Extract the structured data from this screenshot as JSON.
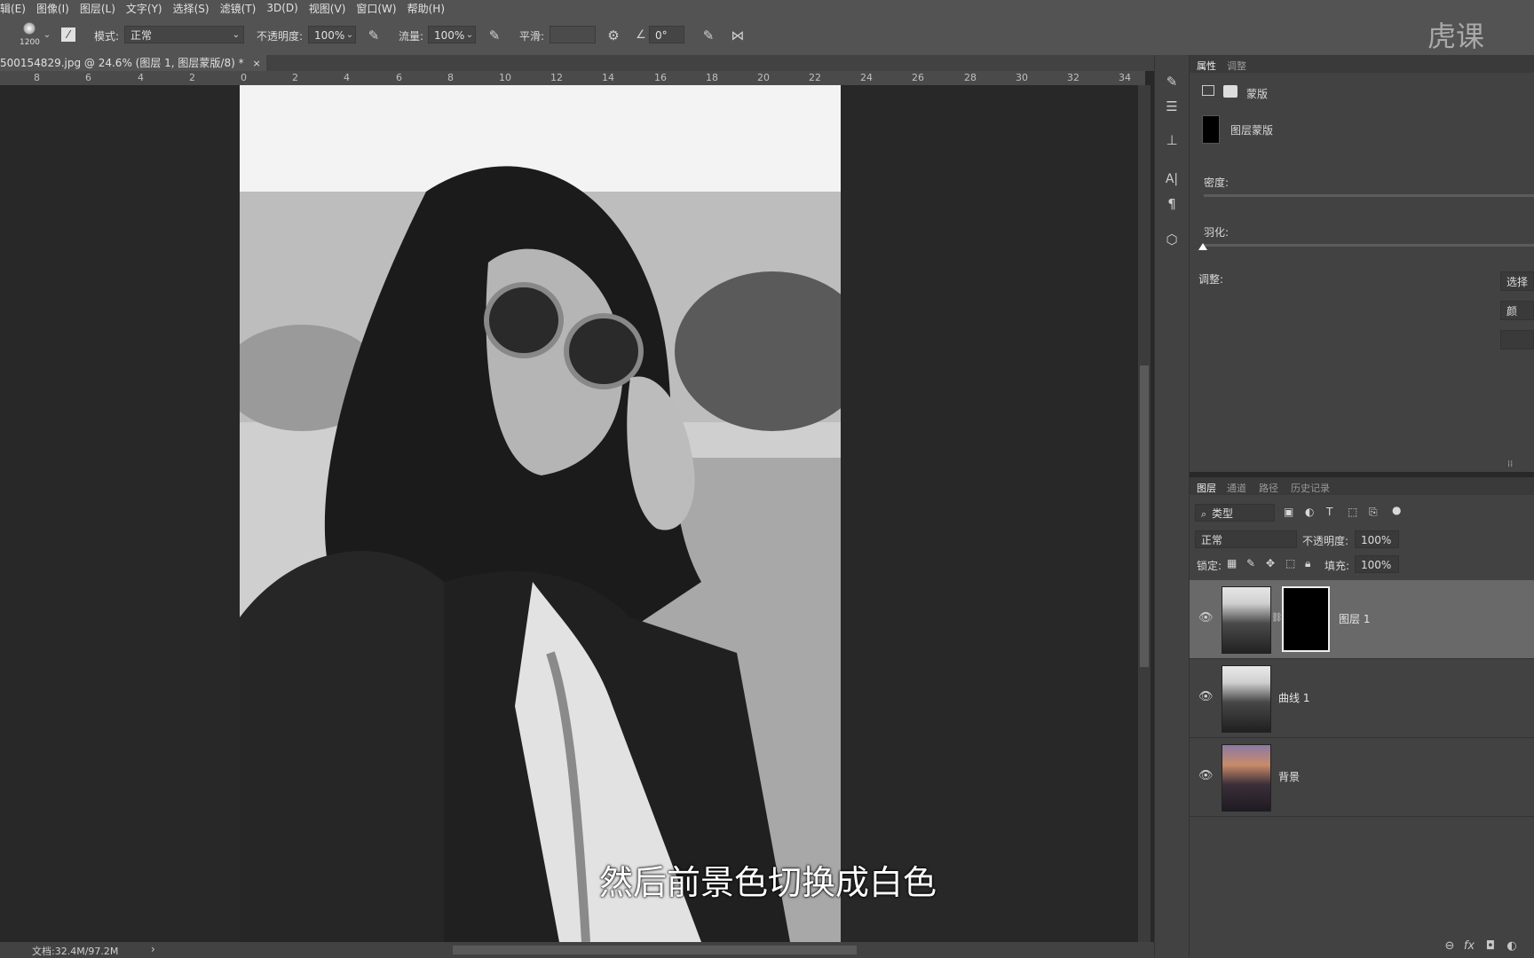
{
  "menu": [
    "辑(E)",
    "图像(I)",
    "图层(L)",
    "文字(Y)",
    "选择(S)",
    "滤镜(T)",
    "3D(D)",
    "视图(V)",
    "窗口(W)",
    "帮助(H)"
  ],
  "options": {
    "brush_size": "1200",
    "mode_label": "模式:",
    "mode_value": "正常",
    "opacity_label": "不透明度:",
    "opacity_value": "100%",
    "flow_label": "流量:",
    "flow_value": "100%",
    "smooth_label": "平滑:",
    "smooth_value": "",
    "angle_value": "0°"
  },
  "brand": "虎课",
  "document": {
    "tab_title": "500154829.jpg @ 24.6% (图层 1, 图层蒙版/8) *",
    "close_glyph": "×",
    "ruler_marks": [
      "8",
      "6",
      "4",
      "2",
      "0",
      "2",
      "4",
      "6",
      "8",
      "10",
      "12",
      "14",
      "16",
      "18",
      "20",
      "22",
      "24",
      "26",
      "28",
      "30",
      "32",
      "34"
    ],
    "subtitle": "然后前景色切换成白色",
    "status_text": "文档:32.4M/97.2M",
    "status_arrow": "›"
  },
  "properties_panel": {
    "tabs": [
      "属性",
      "调整"
    ],
    "mask_header": "蒙版",
    "layer_mask_label": "图层蒙版",
    "density_label": "密度:",
    "feather_label": "羽化:",
    "adjust_label": "调整:",
    "btn_select": "选择",
    "btn_color": "颜"
  },
  "layers_panel": {
    "tabs": [
      "图层",
      "通道",
      "路径",
      "历史记录"
    ],
    "filter_kind": "类型",
    "blend_mode": "正常",
    "opacity_label": "不透明度:",
    "opacity_value": "100%",
    "lock_label": "锁定:",
    "fill_label": "填充:",
    "fill_value": "100%",
    "layers": [
      {
        "name": "图层 1",
        "has_mask": true,
        "selected": true
      },
      {
        "name": "曲线 1",
        "has_mask": false,
        "selected": false
      },
      {
        "name": "背景",
        "has_mask": false,
        "selected": false
      }
    ],
    "footer_icons": [
      "link-icon",
      "fx-icon",
      "mask-icon",
      "adjustment-icon"
    ],
    "fx_label": "fx"
  }
}
